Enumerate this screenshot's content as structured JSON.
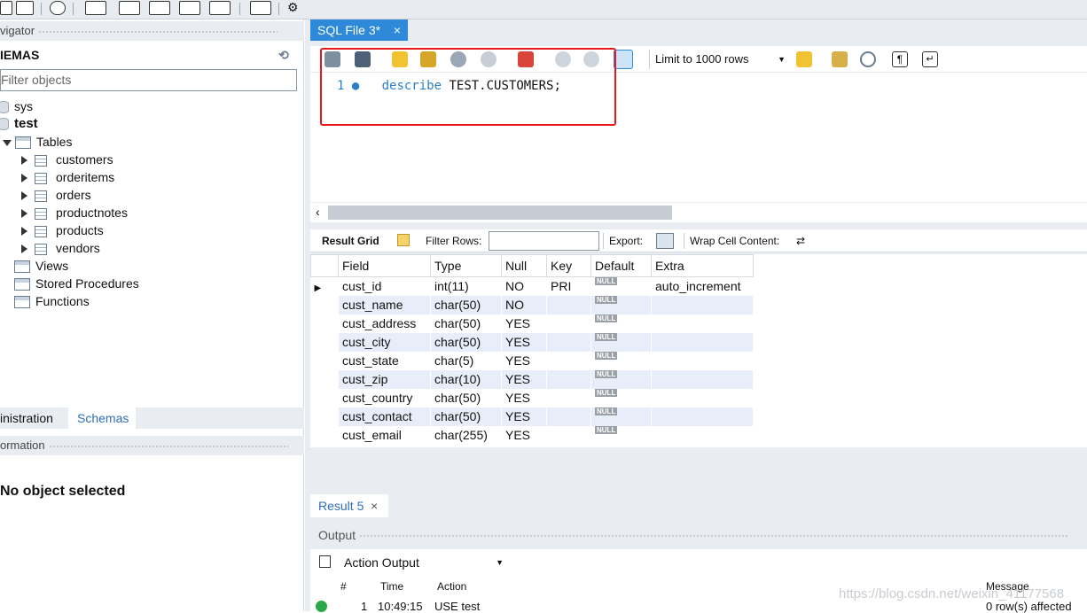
{
  "left": {
    "navigator_title": "vigator",
    "schemas_title": "IEMAS",
    "filter_placeholder": "Filter objects",
    "tree": {
      "sys": "sys",
      "test": "test",
      "tables": "Tables",
      "table_items": [
        "customers",
        "orderitems",
        "orders",
        "productnotes",
        "products",
        "vendors"
      ],
      "views": "Views",
      "procedures": "Stored Procedures",
      "functions": "Functions"
    },
    "tabs": {
      "administration": "inistration",
      "schemas": "Schemas"
    },
    "information_title": "ormation",
    "no_object": "No object selected"
  },
  "editor": {
    "tab_label": "SQL File 3*",
    "limit_label": "Limit to 1000 rows",
    "line_number": "1",
    "code_keyword": "describe",
    "code_rest": " TEST.CUSTOMERS;"
  },
  "result_toolbar": {
    "result_grid": "Result Grid",
    "filter_rows": "Filter Rows:",
    "export": "Export:",
    "wrap": "Wrap Cell Content:"
  },
  "grid": {
    "columns": [
      "Field",
      "Type",
      "Null",
      "Key",
      "Default",
      "Extra"
    ],
    "null_badge": "NULL",
    "rows": [
      {
        "field": "cust_id",
        "type": "int(11)",
        "null": "NO",
        "key": "PRI",
        "extra": "auto_increment"
      },
      {
        "field": "cust_name",
        "type": "char(50)",
        "null": "NO",
        "key": "",
        "extra": ""
      },
      {
        "field": "cust_address",
        "type": "char(50)",
        "null": "YES",
        "key": "",
        "extra": ""
      },
      {
        "field": "cust_city",
        "type": "char(50)",
        "null": "YES",
        "key": "",
        "extra": ""
      },
      {
        "field": "cust_state",
        "type": "char(5)",
        "null": "YES",
        "key": "",
        "extra": ""
      },
      {
        "field": "cust_zip",
        "type": "char(10)",
        "null": "YES",
        "key": "",
        "extra": ""
      },
      {
        "field": "cust_country",
        "type": "char(50)",
        "null": "YES",
        "key": "",
        "extra": ""
      },
      {
        "field": "cust_contact",
        "type": "char(50)",
        "null": "YES",
        "key": "",
        "extra": ""
      },
      {
        "field": "cust_email",
        "type": "char(255)",
        "null": "YES",
        "key": "",
        "extra": ""
      }
    ]
  },
  "bottom": {
    "result_tab": "Result 5",
    "output_title": "Output",
    "output_select": "Action Output",
    "cols": {
      "hash": "#",
      "time": "Time",
      "action": "Action",
      "message": "Message"
    },
    "row": {
      "num": "1",
      "time": "10:49:15",
      "action": "USE test",
      "message": "0 row(s) affected"
    },
    "watermark": "https://blog.csdn.net/weixin_41177568"
  },
  "colors": {
    "tab_active": "#2e8ad8",
    "highlight_box": "#e8181d",
    "keyword": "#2a7fc9"
  }
}
